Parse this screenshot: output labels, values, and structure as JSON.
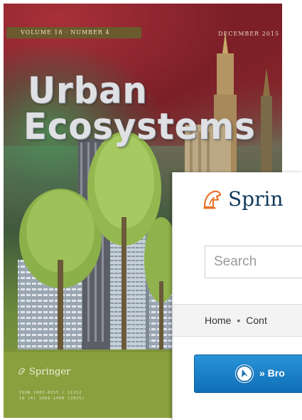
{
  "cover": {
    "volume_line": "VOLUME 18 · NUMBER 4",
    "date": "DECEMBER 2015",
    "title_line1": "Urban",
    "title_line2": "Ecosystems",
    "publisher": "Springer",
    "issn_line1": "ISSN 1083-8155 / 11252",
    "issn_line2": "18 (4) 1069-1408 (2015)"
  },
  "web": {
    "logo_text": "Sprin",
    "search_placeholder": "Search",
    "breadcrumb": {
      "home": "Home",
      "separator": "•",
      "next": "Cont"
    },
    "browse_label": "» Bro",
    "brand_color": "#12395a",
    "button_color": "#1a80c8"
  }
}
